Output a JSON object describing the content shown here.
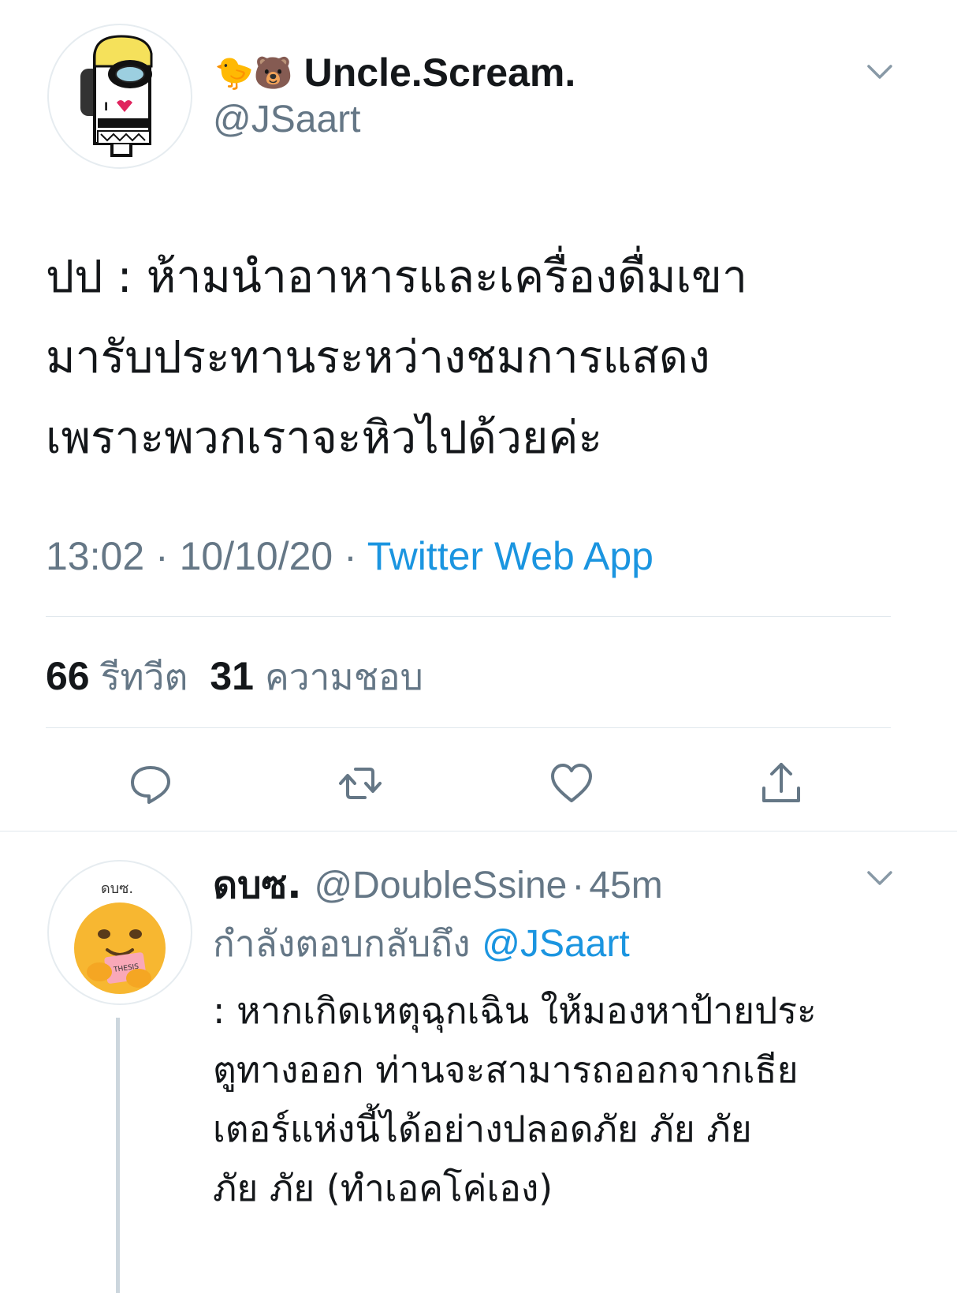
{
  "main_tweet": {
    "display_name_emoji": "🐤🐻",
    "display_name": "Uncle.Scream.",
    "handle": "@JSaart",
    "text_lines": [
      "ปป : ห้ามนำอาหารและเครื่องดื่มเขา",
      "มารับประทานระหว่างชมการแสดง",
      "เพราะพวกเราจะหิวไปด้วยค่ะ"
    ],
    "time": "13:02",
    "sep1": "·",
    "date": "10/10/20",
    "sep2": "·",
    "source": "Twitter Web App"
  },
  "stats": {
    "retweets_count": "66",
    "retweets_label": "รีทวีต",
    "likes_count": "31",
    "likes_label": "ความชอบ"
  },
  "actions": {
    "reply_icon": "reply-icon",
    "retweet_icon": "retweet-icon",
    "like_icon": "heart-icon",
    "share_icon": "share-icon"
  },
  "reply": {
    "avatar_text": "ดบซ.",
    "display_name": "ดบซ.",
    "handle": "@DoubleSsine",
    "sep": "·",
    "time_ago": "45m",
    "replying_to_label": "กำลังตอบกลับถึง",
    "replying_to_handle": "@JSaart",
    "text_lines": [
      ": หากเกิดเหตุฉุกเฉิน ให้มองหาป้ายประ",
      "ตูทางออก ท่านจะสามารถออกจากเธีย",
      "เตอร์แห่งนี้ได้อย่างปลอดภัย ภัย ภัย",
      "ภัย ภัย (ทำเอคโค่เอง)"
    ]
  },
  "colors": {
    "text": "#14171a",
    "muted": "#657786",
    "link": "#1b95e0",
    "divider": "#e1e8ed"
  }
}
